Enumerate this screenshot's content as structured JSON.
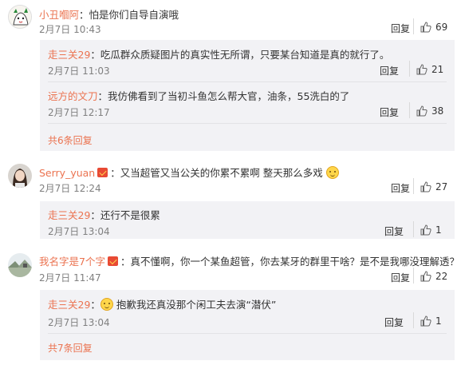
{
  "comments": [
    {
      "user": "小丑嗰阿",
      "text": "：怕是你们自导自演哦",
      "time": "2月7日 10:43",
      "reply_label": "回复",
      "likes": "69",
      "avatar_icon": "cartoon-avatar",
      "replies": [
        {
          "user": "走三关29",
          "text": "：吃瓜群众质疑图片的真实性无所谓，只要某台知道是真的就行了。",
          "time": "2月7日 11:03",
          "reply_label": "回复",
          "likes": "21"
        },
        {
          "user": "远方的文刀",
          "text": "：我仿佛看到了当初斗鱼怎么帮大官，油条，55洗白的了",
          "time": "2月7日 12:17",
          "reply_label": "回复",
          "likes": "38"
        }
      ],
      "more_replies": "共6条回复"
    },
    {
      "user": "Serry_yuan",
      "badge_icon": "vip-badge-icon",
      "text": "：又当超管又当公关的你累不累啊 整天那么多戏",
      "emoji_icon": "smirk-emoji-icon",
      "time": "2月7日 12:24",
      "reply_label": "回复",
      "likes": "27",
      "avatar_icon": "girl-photo-avatar",
      "replies": [
        {
          "user": "走三关29",
          "text": "：还行不是很累",
          "time": "2月7日 13:04",
          "reply_label": "回复",
          "likes": "1"
        }
      ]
    },
    {
      "user": "我名字是7个字",
      "badge_icon": "vip-badge-icon",
      "text": "：真不懂啊，你一个某鱼超管，你去某牙的群里干啥？是不是我哪没理解透？",
      "time": "2月7日 11:47",
      "reply_label": "回复",
      "likes": "22",
      "avatar_icon": "landscape-avatar",
      "replies": [
        {
          "user": "走三关29",
          "text": "抱歉我还真没那个闲工夫去演“潜伏”",
          "emoji_icon": "sweat-emoji-icon",
          "time": "2月7日 13:04",
          "reply_label": "回复",
          "likes": "1"
        }
      ],
      "more_replies": "共7条回复"
    }
  ],
  "colors": {
    "username": "#eb7350",
    "meta": "#808080",
    "sub_bg": "#f2f2f5"
  }
}
